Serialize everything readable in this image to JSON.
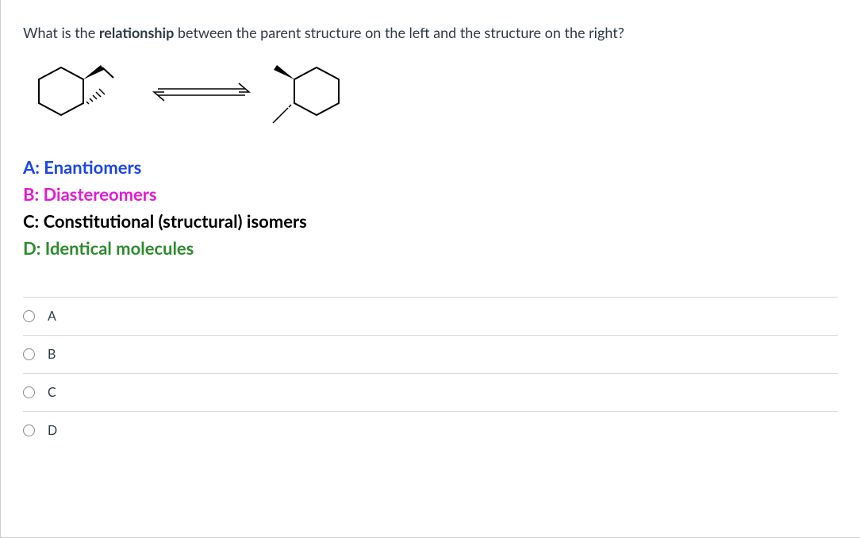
{
  "question": {
    "prefix": "What is the ",
    "bold": "relationship",
    "suffix": " between the parent structure on the left and the structure on the right?"
  },
  "answer_key": {
    "a": "A: Enantiomers",
    "b": "B: Diastereomers",
    "c": "C: Constitutional (structural) isomers",
    "d": "D: Identical molecules"
  },
  "options": [
    {
      "label": "A"
    },
    {
      "label": "B"
    },
    {
      "label": "C"
    },
    {
      "label": "D"
    }
  ]
}
